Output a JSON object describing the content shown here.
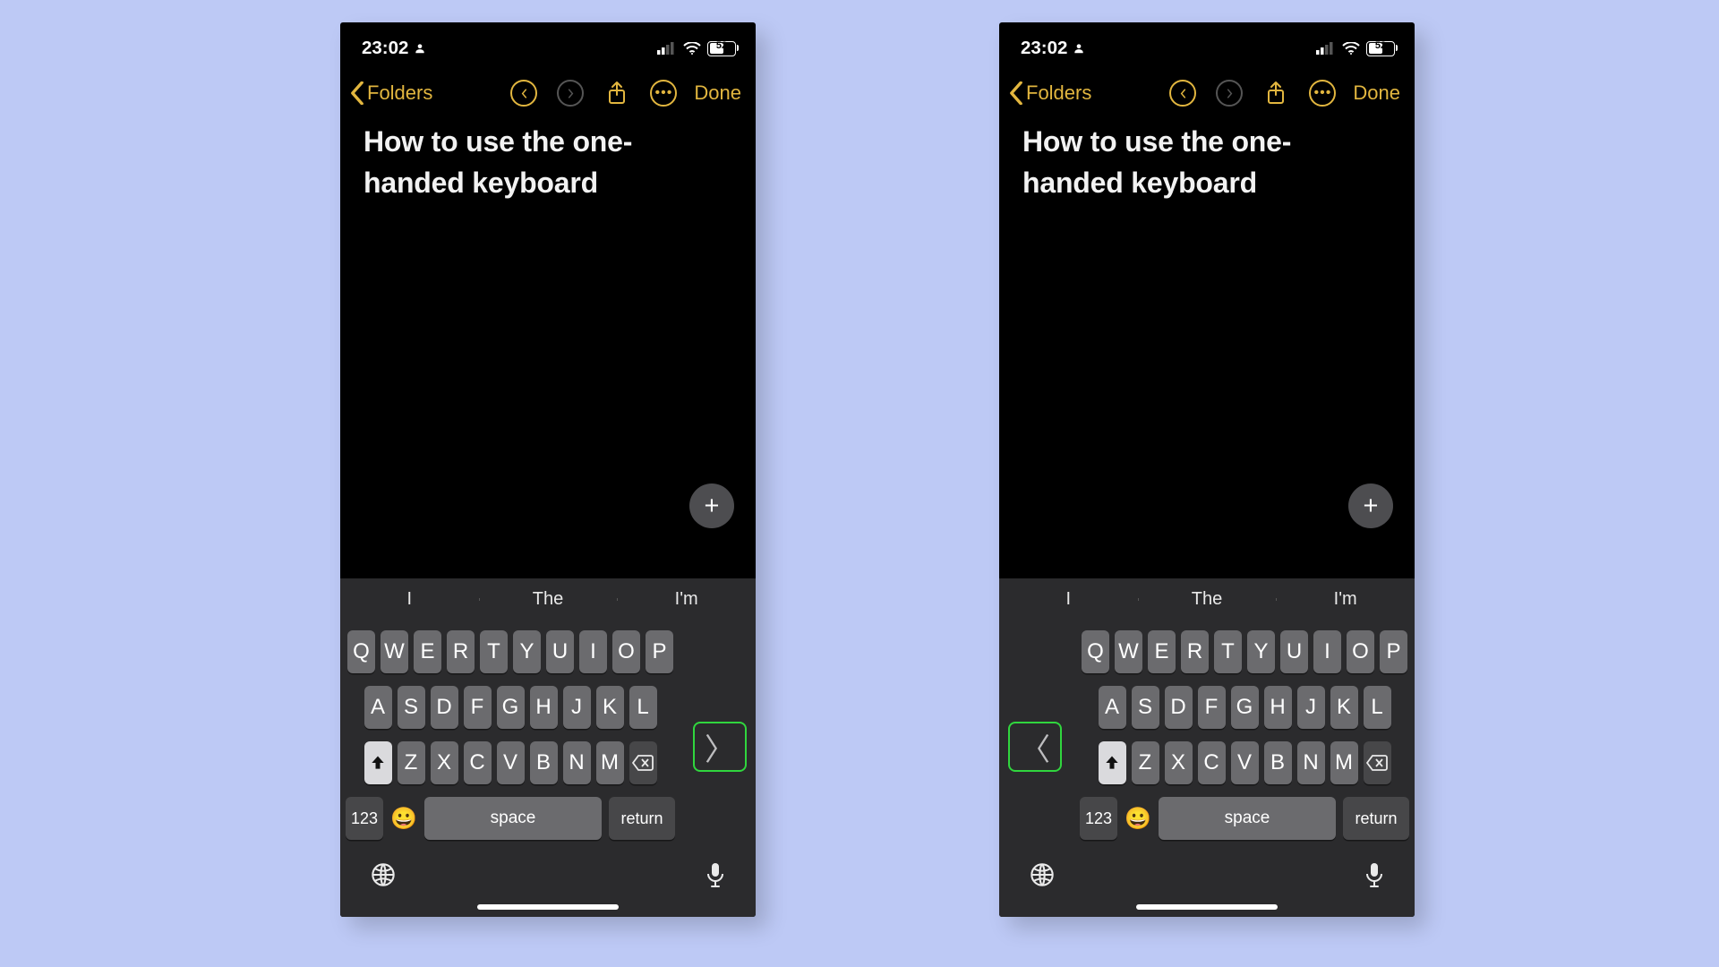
{
  "status": {
    "time": "23:02",
    "battery": "52"
  },
  "toolbar": {
    "back": "Folders",
    "done": "Done"
  },
  "note": {
    "title_line1": "How to use the one-",
    "title_line2": "handed keyboard"
  },
  "suggestions": [
    "I",
    "The",
    "I'm"
  ],
  "keyboard": {
    "row1": [
      "Q",
      "W",
      "E",
      "R",
      "T",
      "Y",
      "U",
      "I",
      "O",
      "P"
    ],
    "row2": [
      "A",
      "S",
      "D",
      "F",
      "G",
      "H",
      "J",
      "K",
      "L"
    ],
    "row3": [
      "Z",
      "X",
      "C",
      "V",
      "B",
      "N",
      "M"
    ],
    "mode": "123",
    "space": "space",
    "return": "return"
  },
  "expand": {
    "left_phone_glyph": "〉",
    "right_phone_glyph": "〈"
  }
}
